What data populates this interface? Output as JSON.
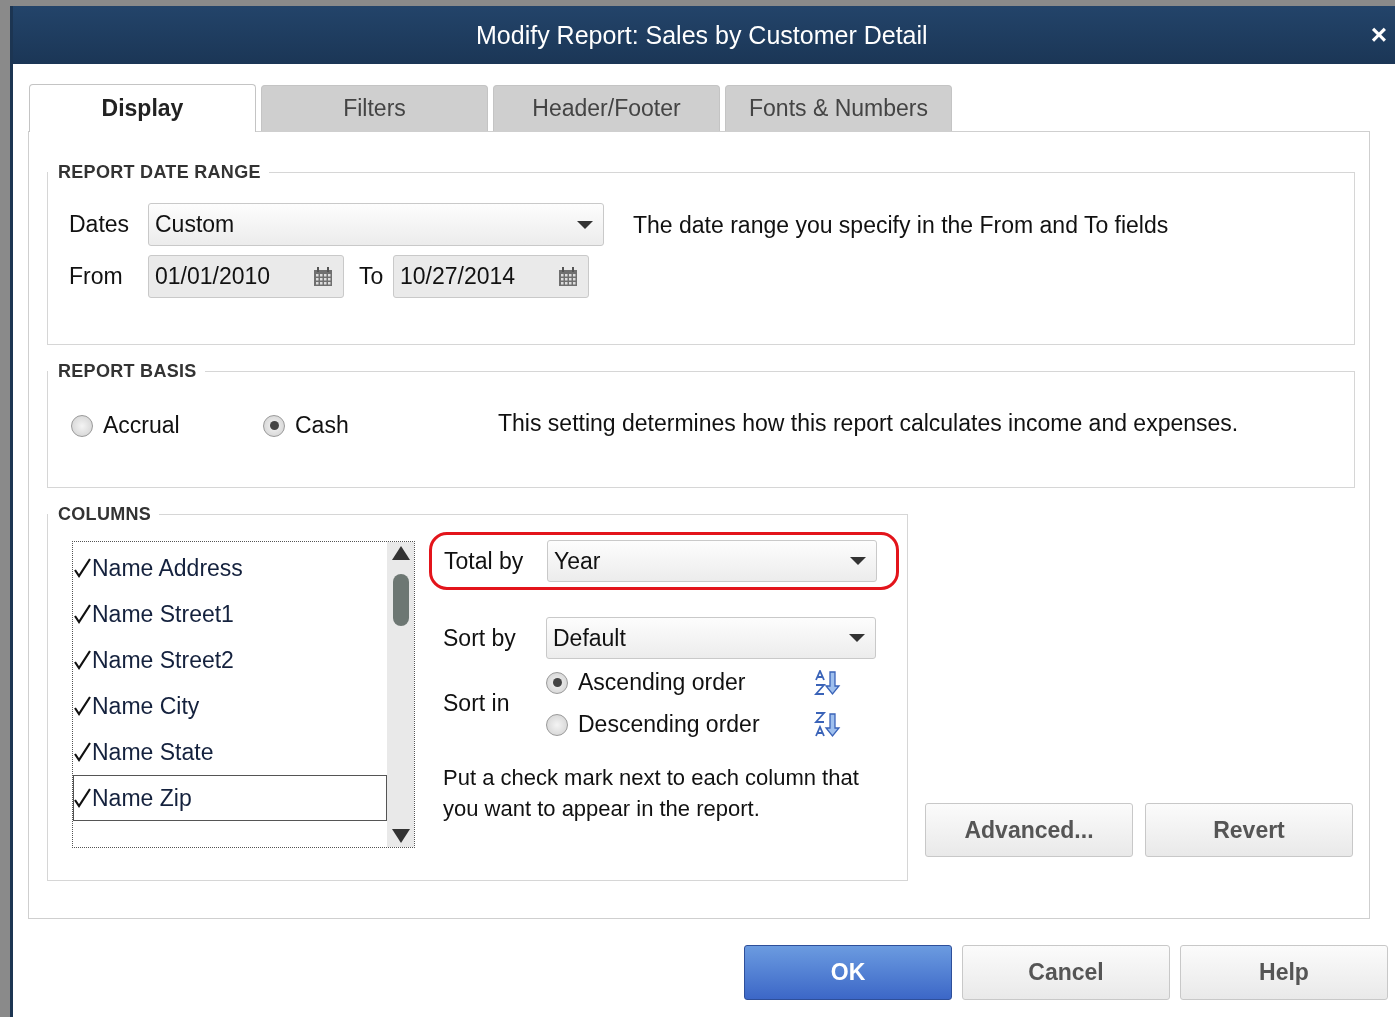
{
  "window": {
    "title": "Modify Report: Sales by Customer Detail",
    "close": "×"
  },
  "tabs": [
    {
      "label": "Display",
      "selected": true
    },
    {
      "label": "Filters",
      "selected": false
    },
    {
      "label": "Header/Footer",
      "selected": false
    },
    {
      "label": "Fonts & Numbers",
      "selected": false
    }
  ],
  "date_range": {
    "heading": "REPORT DATE RANGE",
    "dates_label": "Dates",
    "dates_value": "Custom",
    "from_label": "From",
    "from_value": "01/01/2010",
    "to_label": "To",
    "to_value": "10/27/2014",
    "note": "The date range you specify in the From and To fields"
  },
  "basis": {
    "heading": "REPORT BASIS",
    "options": [
      {
        "label": "Accrual",
        "selected": false
      },
      {
        "label": "Cash",
        "selected": true
      }
    ],
    "note": "This setting determines how this report calculates income and expenses."
  },
  "columns": {
    "heading": "COLUMNS",
    "items": [
      {
        "label": "Name Address",
        "checked": true,
        "selected": false
      },
      {
        "label": "Name Street1",
        "checked": true,
        "selected": false
      },
      {
        "label": "Name Street2",
        "checked": true,
        "selected": false
      },
      {
        "label": "Name City",
        "checked": true,
        "selected": false
      },
      {
        "label": "Name State",
        "checked": true,
        "selected": false
      },
      {
        "label": "Name Zip",
        "checked": true,
        "selected": true
      }
    ],
    "total_by": {
      "label": "Total by",
      "value": "Year",
      "highlighted": true
    },
    "sort_by": {
      "label": "Sort by",
      "value": "Default"
    },
    "sort_in": {
      "label": "Sort in",
      "options": [
        {
          "label": "Ascending order",
          "selected": true,
          "kind": "ascending"
        },
        {
          "label": "Descending order",
          "selected": false,
          "kind": "descending"
        }
      ]
    },
    "note": "Put a check mark next to each column that you want to appear in the report."
  },
  "side_buttons": [
    "Advanced...",
    "Revert"
  ],
  "buttons": [
    {
      "label": "OK",
      "default": true
    },
    {
      "label": "Cancel",
      "default": false
    },
    {
      "label": "Help",
      "default": false
    }
  ]
}
